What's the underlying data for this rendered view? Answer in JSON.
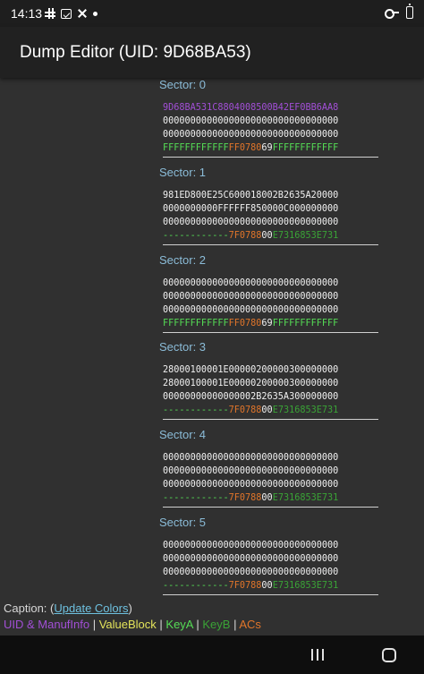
{
  "status_bar": {
    "time": "14:13",
    "icons": [
      "slack-icon",
      "calendar-icon",
      "tools-icon",
      "dot-icon",
      "key-icon",
      "battery-icon"
    ]
  },
  "app_bar": {
    "title": "Dump Editor (UID: 9D68BA53)"
  },
  "sectors": [
    {
      "label": "Sector: 0",
      "lines": [
        [
          {
            "t": "9D68BA531C8804008500B42EF0BB6AA8",
            "c": "uid"
          }
        ],
        [
          {
            "t": "00000000000000000000000000000000",
            "c": "plain"
          }
        ],
        [
          {
            "t": "00000000000000000000000000000000",
            "c": "plain"
          }
        ],
        [
          {
            "t": "FFFFFFFFFFFF",
            "c": "keya"
          },
          {
            "t": "FF0780",
            "c": "acs"
          },
          {
            "t": "69",
            "c": "plain"
          },
          {
            "t": "FFFFFFFFFFFF",
            "c": "keya"
          }
        ]
      ]
    },
    {
      "label": "Sector: 1",
      "lines": [
        [
          {
            "t": "981ED800E25C600018002B2635A20000",
            "c": "plain"
          }
        ],
        [
          {
            "t": "0000000000FFFFFF850000C000000000",
            "c": "plain"
          }
        ],
        [
          {
            "t": "00000000000000000000000000000000",
            "c": "plain"
          }
        ],
        [
          {
            "t": "------------",
            "c": "keya"
          },
          {
            "t": "7F0788",
            "c": "acs"
          },
          {
            "t": "00",
            "c": "plain"
          },
          {
            "t": "E7316853E731",
            "c": "keyb"
          }
        ]
      ]
    },
    {
      "label": "Sector: 2",
      "lines": [
        [
          {
            "t": "00000000000000000000000000000000",
            "c": "plain"
          }
        ],
        [
          {
            "t": "00000000000000000000000000000000",
            "c": "plain"
          }
        ],
        [
          {
            "t": "00000000000000000000000000000000",
            "c": "plain"
          }
        ],
        [
          {
            "t": "FFFFFFFFFFFF",
            "c": "keya"
          },
          {
            "t": "FF0780",
            "c": "acs"
          },
          {
            "t": "69",
            "c": "plain"
          },
          {
            "t": "FFFFFFFFFFFF",
            "c": "keya"
          }
        ]
      ]
    },
    {
      "label": "Sector: 3",
      "lines": [
        [
          {
            "t": "28000100001E00000200000300000000",
            "c": "plain"
          }
        ],
        [
          {
            "t": "28000100001E00000200000300000000",
            "c": "plain"
          }
        ],
        [
          {
            "t": "00000000000000002B2635A300000000",
            "c": "plain"
          }
        ],
        [
          {
            "t": "------------",
            "c": "keya"
          },
          {
            "t": "7F0788",
            "c": "acs"
          },
          {
            "t": "00",
            "c": "plain"
          },
          {
            "t": "E7316853E731",
            "c": "keyb"
          }
        ]
      ]
    },
    {
      "label": "Sector: 4",
      "lines": [
        [
          {
            "t": "00000000000000000000000000000000",
            "c": "plain"
          }
        ],
        [
          {
            "t": "00000000000000000000000000000000",
            "c": "plain"
          }
        ],
        [
          {
            "t": "00000000000000000000000000000000",
            "c": "plain"
          }
        ],
        [
          {
            "t": "------------",
            "c": "keya"
          },
          {
            "t": "7F0788",
            "c": "acs"
          },
          {
            "t": "00",
            "c": "plain"
          },
          {
            "t": "E7316853E731",
            "c": "keyb"
          }
        ]
      ]
    },
    {
      "label": "Sector: 5",
      "lines": [
        [
          {
            "t": "00000000000000000000000000000000",
            "c": "plain"
          }
        ],
        [
          {
            "t": "00000000000000000000000000000000",
            "c": "plain"
          }
        ],
        [
          {
            "t": "00000000000000000000000000000000",
            "c": "plain"
          }
        ],
        [
          {
            "t": "------------",
            "c": "keya"
          },
          {
            "t": "7F0788",
            "c": "acs"
          },
          {
            "t": "00",
            "c": "plain"
          },
          {
            "t": "E7316853E731",
            "c": "keyb"
          }
        ]
      ]
    }
  ],
  "caption": {
    "prefix": "Caption: (",
    "link": "Update Colors",
    "suffix": ")"
  },
  "legend": {
    "uid": "UID & ManufInfo",
    "value_block": "ValueBlock",
    "key_a": "KeyA",
    "key_b": "KeyB",
    "acs": "ACs",
    "separator": " | "
  },
  "colors": {
    "uid": "#a24fd6",
    "value_block": "#e3e35a",
    "key_a": "#55dd55",
    "key_b": "#3aa336",
    "acs": "#e0752a",
    "sector_label": "#8bbcd8"
  },
  "nav_bar": {
    "icons": [
      "recents-icon",
      "home-icon"
    ]
  }
}
